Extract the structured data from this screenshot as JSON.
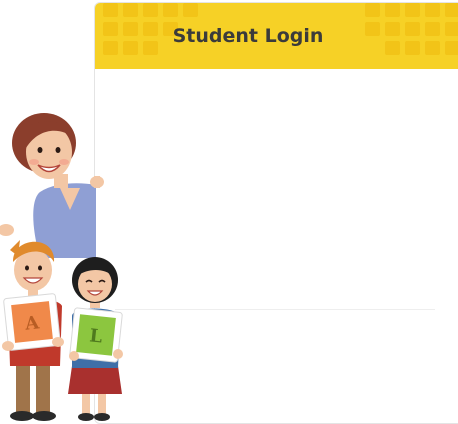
{
  "login_card": {
    "title": "Student Login"
  },
  "illustration": {
    "sign_left_letter": "A",
    "sign_right_letter": "L"
  },
  "colors": {
    "header_yellow": "#f6d126",
    "header_tile": "#f2c418",
    "sign_orange": "#f0894a",
    "sign_green": "#8cc63f"
  }
}
